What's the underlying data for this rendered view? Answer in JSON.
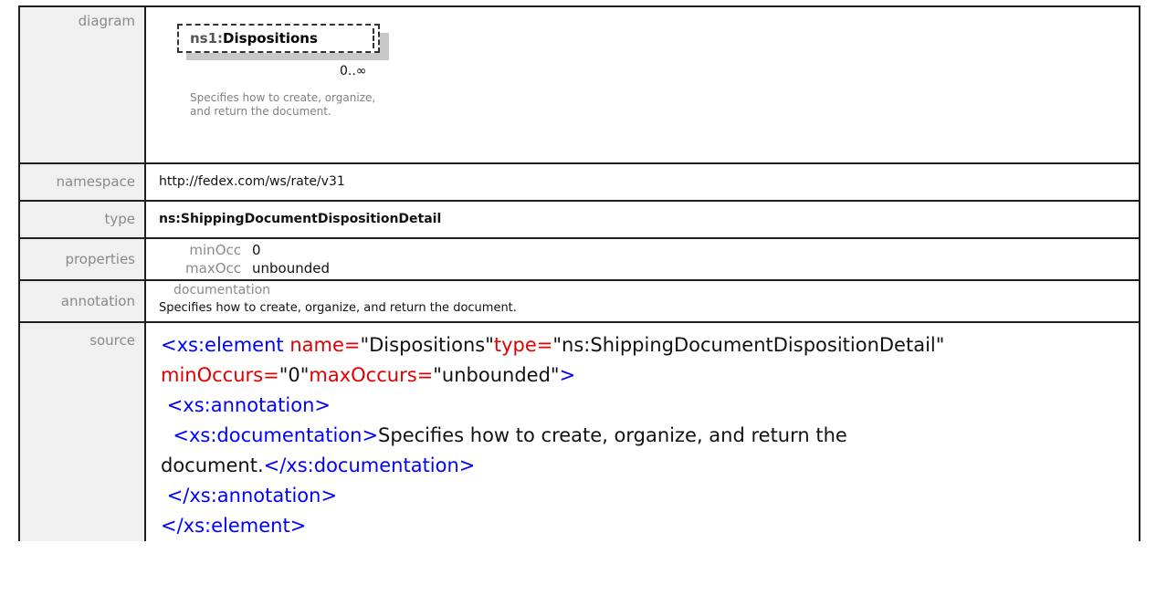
{
  "labels": {
    "diagram": "diagram",
    "namespace": "namespace",
    "type": "type",
    "properties": "properties",
    "annotation": "annotation",
    "source": "source"
  },
  "diagram": {
    "node_prefix": "ns1:",
    "node_name": "Dispositions",
    "cardinality": "0..∞",
    "note": "Specifies how to create, organize, and return the document."
  },
  "namespace": "http://fedex.com/ws/rate/v31",
  "type": "ns:ShippingDocumentDispositionDetail",
  "properties": {
    "min_key": "minOcc",
    "min_val": "0",
    "max_key": "maxOcc",
    "max_val": "unbounded"
  },
  "annotation": {
    "heading": "documentation",
    "text": "Specifies how to create, organize, and return the document."
  },
  "source": {
    "l1_tag": "<xs:element",
    "l1_attr1": " name=",
    "l1_val1": "\"Dispositions\"",
    "l1_attr2": "type=",
    "l1_val2": "\"ns:ShippingDocumentDispositionDetail\"",
    "l2_attr1": "minOccurs=",
    "l2_val1": "\"0\"",
    "l2_attr2": "maxOccurs=",
    "l2_val2": "\"unbounded\"",
    "l2_close": ">",
    "l3": "<xs:annotation>",
    "l4_tag": "<xs:documentation>",
    "l4_text": "Specifies how to create, organize, and return the",
    "l5_text": "document.",
    "l5_tag": "</xs:documentation>",
    "l6": "</xs:annotation>",
    "l7": "</xs:element>"
  }
}
